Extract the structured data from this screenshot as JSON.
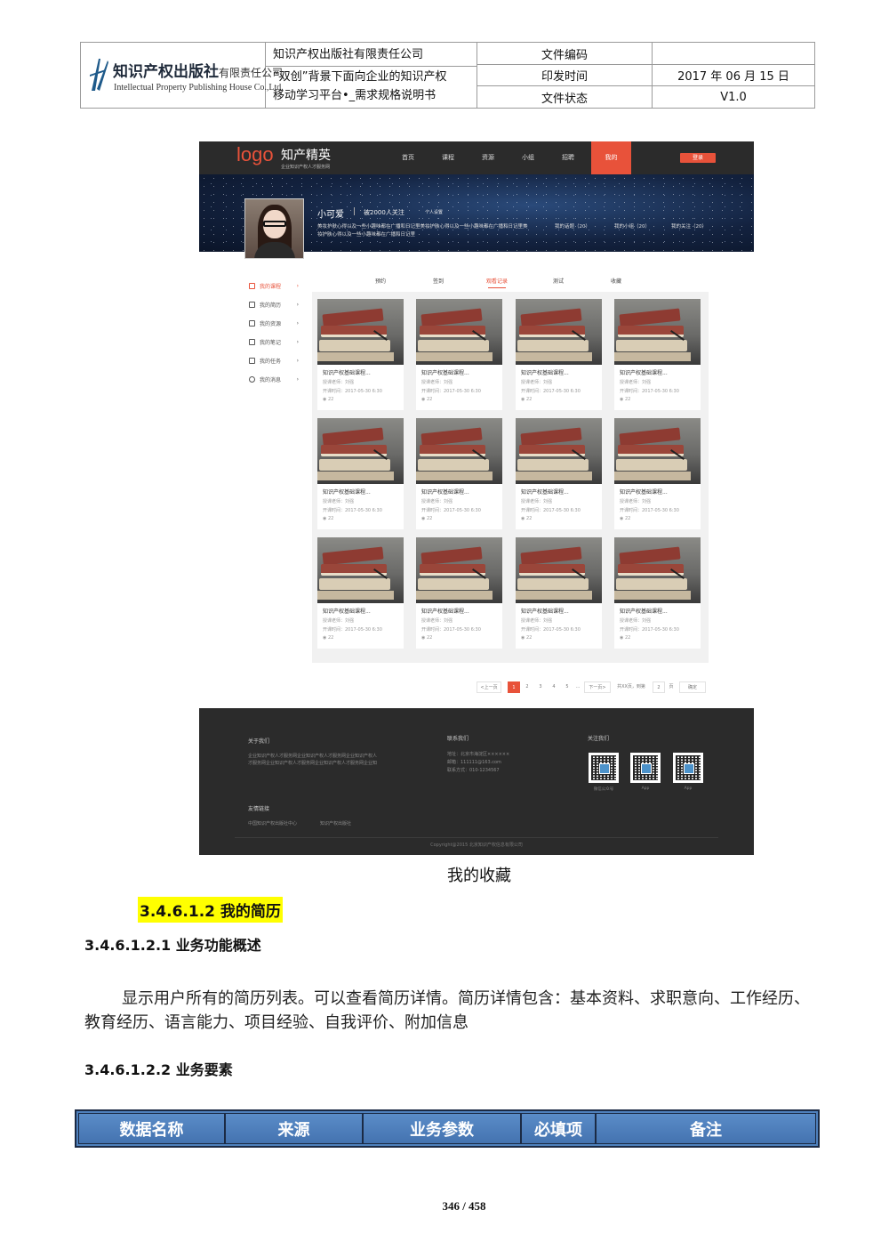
{
  "header": {
    "logo_cn": "知识产权出版社",
    "logo_cn_suffix": "有限责任公司",
    "logo_en": "Intellectual Property Publishing House Co.,Ltd.",
    "company": "知识产权出版社有限责任公司",
    "doc_title_line1": "“双创”背景下面向企业的知识产权",
    "doc_title_line2": "移动学习平台•_需求规格说明书",
    "label_code": "文件编码",
    "value_code": "",
    "label_print": "印发时间",
    "value_print": "2017 年 06 月 15 日",
    "label_status": "文件状态",
    "value_status": "V1.0"
  },
  "screenshot": {
    "nav": {
      "logo": "logo",
      "brand": "知产精英",
      "slogan": "企业知识产权人才服务网",
      "items": [
        "首页",
        "课程",
        "资源",
        "小组",
        "招聘",
        "我的"
      ],
      "login": "登录"
    },
    "profile": {
      "name": "小可爱",
      "fans": "被2000人关注",
      "settings": "个人设置",
      "bio": "美妆护肤心得以及一些小趣味都在广播和日记里美妆护肤心得以及一些小趣味都在广播和日记里美妆护肤心得以及一些小趣味都在广播和日记里",
      "stats": [
        "我的话题（20）",
        "我的小组（20）",
        "我的关注（20）"
      ]
    },
    "sidebar": [
      "我的课程",
      "我的简历",
      "我的资源",
      "我的笔记",
      "我的任务",
      "我的消息"
    ],
    "tabs": [
      "预约",
      "签到",
      "观看记录",
      "测试",
      "收藏"
    ],
    "card": {
      "title": "知识产权基础课程...",
      "teacher": "授课老师：刘强",
      "time": "开课时间：2017-05-30 6:30",
      "views": "22"
    },
    "pager": {
      "prev": "<上一页",
      "pages": [
        "1",
        "2",
        "3",
        "4",
        "5"
      ],
      "ellipsis": "...",
      "next": "下一页>",
      "total": "共XX页，到第",
      "input": "2",
      "unit": "页",
      "confirm": "确定"
    },
    "footer": {
      "about_title": "关于我们",
      "about_text": "企业知识产权人才服务网企业知识产权人才服务网企业知识产权人才服务网企业知识产权人才服务网企业知识产权人才服务网企业知识产权人才服务网",
      "contact_title": "联系我们",
      "contact_address": "地址：北京市海淀区××××××",
      "contact_email": "邮箱：111111@163.com",
      "contact_phone": "联系方式：010-1234567",
      "follow_title": "关注我们",
      "qr_labels": [
        "微信公众号",
        "App",
        "App"
      ],
      "links_title": "友情链接",
      "links": [
        "中国知识产权出版社中心",
        "知识产权出版社"
      ],
      "copyright": "Copyright@2015 北京知识产权信息有限公司"
    }
  },
  "caption": "我的收藏",
  "sections": {
    "h1": "3.4.6.1.2 我的简历",
    "h2": "3.4.6.1.2.1 业务功能概述",
    "para": "显示用户所有的简历列表。可以查看简历详情。简历详情包含：基本资料、求职意向、工作经历、教育经历、语言能力、项目经验、自我评价、附加信息",
    "h3": "3.4.6.1.2.2 业务要素"
  },
  "table_headers": [
    "数据名称",
    "来源",
    "业务参数",
    "必填项",
    "备注"
  ],
  "page_number": "346 / 458",
  "colors": {
    "accent": "#e8523a",
    "table_header": "#4f81bd",
    "highlight": "#ffff00"
  }
}
